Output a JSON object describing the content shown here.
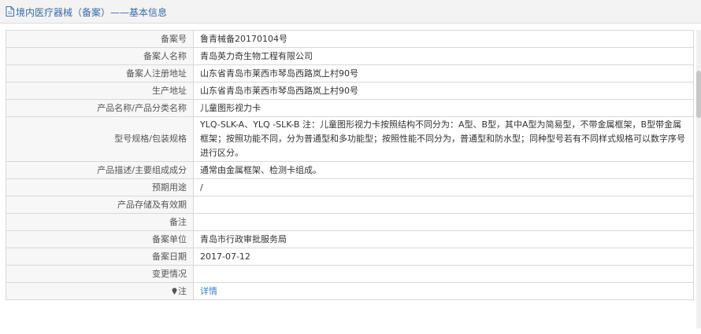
{
  "header": {
    "title": "境内医疗器械（备案）——基本信息"
  },
  "rows": [
    {
      "label": "备案号",
      "value": "鲁青械备20170104号"
    },
    {
      "label": "备案人名称",
      "value": "青岛英力奇生物工程有限公司"
    },
    {
      "label": "备案人注册地址",
      "value": "山东省青岛市莱西市琴岛西路岚上村90号"
    },
    {
      "label": "生产地址",
      "value": "山东省青岛市莱西市琴岛西路岚上村90号"
    },
    {
      "label": "产品名称/产品分类名称",
      "value": "儿童图形视力卡"
    },
    {
      "label": "型号规格/包装规格",
      "value": "YLQ-SLK-A、YLQ -SLK-B 注：儿童图形视力卡按照结构不同分为：A型、B型，其中A型为简易型，不带金属框架，B型带金属框架；按照功能不同，分为普通型和多功能型；按照性能不同分为，普通型和防水型；同种型号若有不同样式规格可以数字序号进行区分。"
    },
    {
      "label": "产品描述/主要组成成分",
      "value": "通常由金属框架、检测卡组成。"
    },
    {
      "label": "预期用途",
      "value": "/"
    },
    {
      "label": "产品存储及有效期",
      "value": ""
    },
    {
      "label": "备注",
      "value": ""
    },
    {
      "label": "备案单位",
      "value": "青岛市行政审批服务局"
    },
    {
      "label": "备案日期",
      "value": "2017-07-12"
    },
    {
      "label": "变更情况",
      "value": ""
    }
  ],
  "note": {
    "label": "注",
    "link_text": "详情"
  },
  "colors": {
    "title": "#3a6aa8",
    "link": "#3d7fc7",
    "label_bg": "#f7f7f7",
    "border": "#d8d8d8"
  },
  "icons": {
    "header": "document-icon",
    "note": "pin-icon"
  }
}
